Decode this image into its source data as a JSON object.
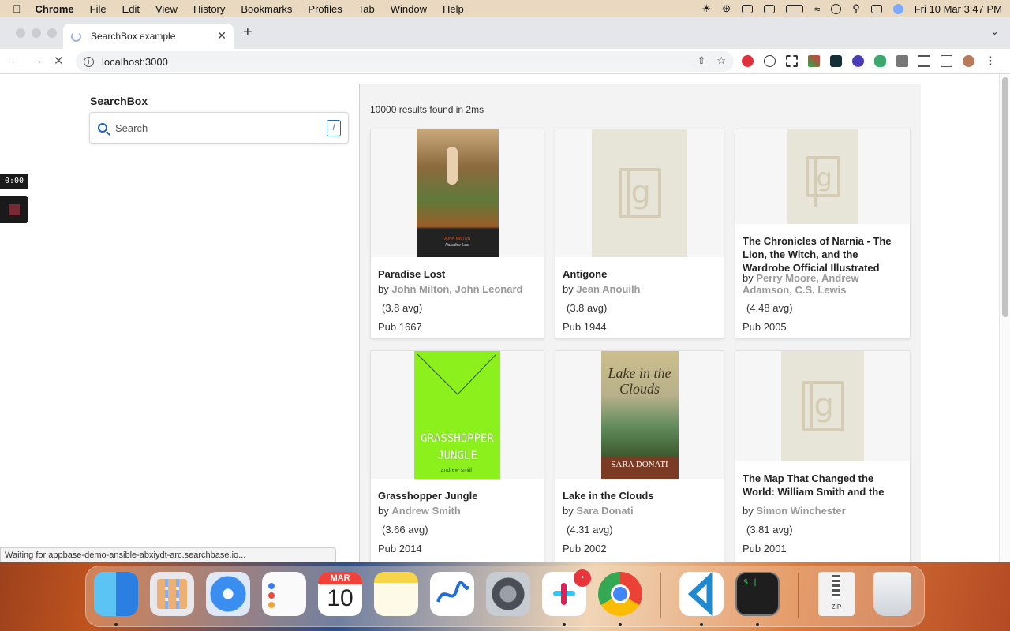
{
  "menubar": {
    "app": "Chrome",
    "items": [
      "File",
      "Edit",
      "View",
      "History",
      "Bookmarks",
      "Profiles",
      "Tab",
      "Window",
      "Help"
    ],
    "datetime": "Fri 10 Mar  3:47 PM"
  },
  "browser": {
    "tab_title": "SearchBox example",
    "url": "localhost:3000",
    "status": "Waiting for appbase-demo-ansible-abxiydt-arc.searchbase.io..."
  },
  "sidebar": {
    "title": "SearchBox",
    "search_placeholder": "Search",
    "shortcut": "/"
  },
  "recorder": {
    "time": "0:00"
  },
  "results": {
    "count_text": "10000 results found in 2ms",
    "cards": [
      {
        "title": "Paradise Lost",
        "by": "by",
        "authors": "John Milton, John Leonard",
        "rating": "(3.8 avg)",
        "pub": "Pub 1667",
        "cover_text": "JOHN MILTON",
        "cover_sub": "Paradise Lost"
      },
      {
        "title": "Antigone",
        "by": "by",
        "authors": "Jean Anouilh",
        "rating": "(3.8 avg)",
        "pub": "Pub 1944"
      },
      {
        "title": "The Chronicles of Narnia - The Lion, the Witch, and the Wardrobe Official Illustrated",
        "by": "by",
        "authors": "Perry Moore, Andrew Adamson, C.S. Lewis",
        "rating": "(4.48 avg)",
        "pub": "Pub 2005"
      },
      {
        "title": "Grasshopper Jungle",
        "by": "by",
        "authors": "Andrew Smith",
        "rating": "(3.66 avg)",
        "pub": "Pub 2014",
        "cover_text": "GRASSHOPPER JUNGLE",
        "cover_sub": "andrew smith"
      },
      {
        "title": "Lake in the Clouds",
        "by": "by",
        "authors": "Sara Donati",
        "rating": "(4.31 avg)",
        "pub": "Pub 2002",
        "cover_text": "Lake in the Clouds",
        "cover_sub": "SARA DONATI"
      },
      {
        "title": "The Map That Changed the World: William Smith and the Birth of Modern Geology",
        "by": "by",
        "authors": "Simon Winchester",
        "rating": "(3.81 avg)",
        "pub": "Pub 2001"
      }
    ]
  },
  "dock": {
    "apps": [
      "finder-icon",
      "launchpad-icon",
      "safari-icon",
      "reminders-icon",
      "calendar-icon",
      "notes-icon",
      "freeform-icon",
      "system-settings-icon",
      "slack-icon",
      "chrome-icon",
      "vscode-icon",
      "terminal-icon",
      "archive-zip-icon",
      "trash-icon"
    ],
    "calendar_month": "MAR",
    "calendar_day": "10",
    "zip_label": "ZIP",
    "terminal_prompt": "$ |"
  }
}
